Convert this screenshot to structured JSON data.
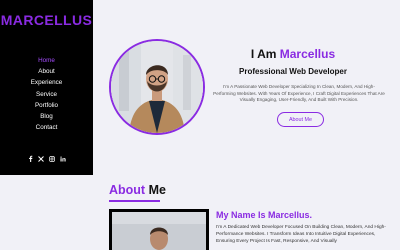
{
  "brand": {
    "name": "MARCELLUS"
  },
  "nav": {
    "items": [
      "Home",
      "About",
      "Experience",
      "Service",
      "Portfolio",
      "Blog",
      "Contact"
    ]
  },
  "social": {
    "icons": [
      "facebook-icon",
      "x-icon",
      "instagram-icon",
      "linkedin-icon"
    ]
  },
  "hero": {
    "title_prefix": "I Am ",
    "title_name": "Marcellus",
    "subtitle": "Professional Web Developer",
    "description": "I'm A Passionate Web Developer Specializing In Clean, Modern, And High-Performing Websites. With Years Of Experience, I Craft Digital Experiences That Are Visually Engaging, User-Friendly, And Built With Precision.",
    "button_label": "About Me"
  },
  "about": {
    "heading_accent": "About",
    "heading_rest": " Me",
    "name_title": "My Name Is Marcellus.",
    "description": "I'm A Dedicated Web Developer Focused On Building Clean, Modern, And High-Performance Websites. I Transform Ideas Into Intuitive Digital Experiences, Ensuring Every Project Is Fast, Responsive, And Visually"
  },
  "colors": {
    "accent": "#8a2be2",
    "sidebar_bg": "#000000",
    "page_bg": "#f1f1f7"
  }
}
